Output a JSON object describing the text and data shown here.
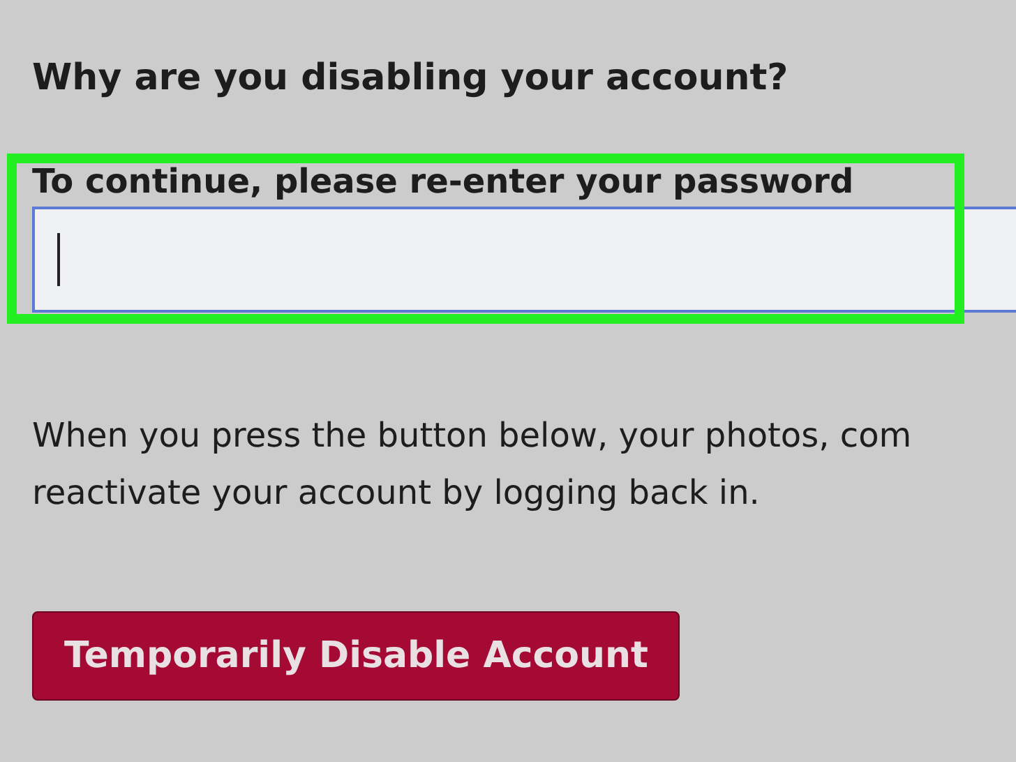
{
  "heading": "Why are you disabling your account?",
  "password_field": {
    "label": "To continue, please re-enter your password",
    "focused": true,
    "highlighted": true
  },
  "notice_lines": [
    "When you press the button below, your photos, com",
    "reactivate your account by logging back in."
  ],
  "disable_button": {
    "label": "Temporarily Disable Account"
  }
}
